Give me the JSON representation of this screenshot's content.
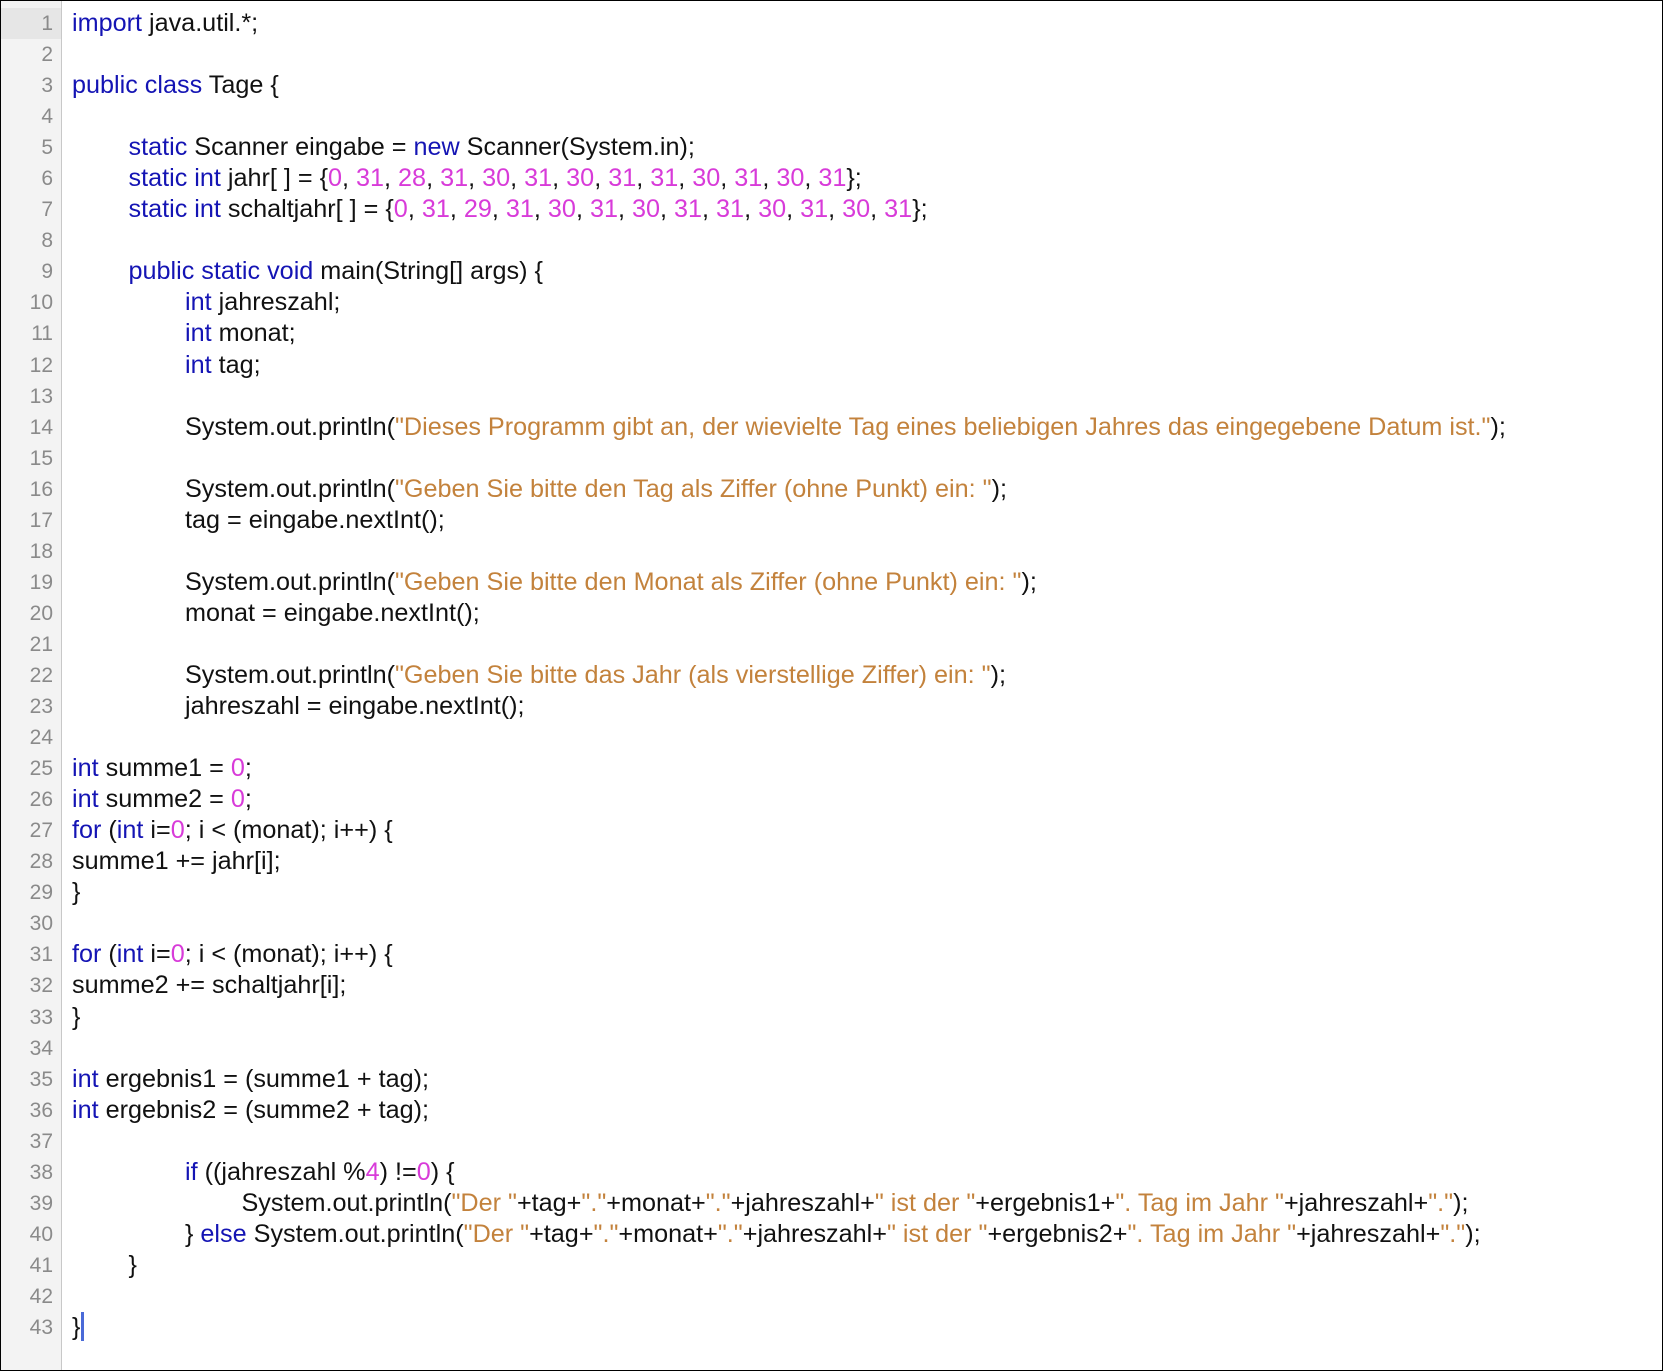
{
  "editor": {
    "current_line": 1,
    "caret_line": 43,
    "indent_unit": "      ",
    "colors": {
      "keyword": "#1414b4",
      "number": "#d83bd9",
      "string": "#c3823c",
      "plain": "#111111",
      "line_number": "#8a8a8a",
      "gutter": "#f3f3f3",
      "caret": "#4a6ad8"
    },
    "lines": [
      {
        "n": "1",
        "indent": 0,
        "tokens": [
          [
            "kw",
            "import"
          ],
          [
            "pl",
            " java.util.*;"
          ]
        ]
      },
      {
        "n": "2",
        "indent": 0,
        "tokens": []
      },
      {
        "n": "3",
        "indent": 0,
        "tokens": [
          [
            "kw",
            "public class"
          ],
          [
            "pl",
            " Tage {"
          ]
        ]
      },
      {
        "n": "4",
        "indent": 0,
        "tokens": []
      },
      {
        "n": "5",
        "indent": 1,
        "tokens": [
          [
            "kw",
            "static"
          ],
          [
            "pl",
            " Scanner eingabe = "
          ],
          [
            "kw",
            "new"
          ],
          [
            "pl",
            " Scanner(System.in);"
          ]
        ]
      },
      {
        "n": "6",
        "indent": 1,
        "tokens": [
          [
            "kw",
            "static int"
          ],
          [
            "pl",
            " jahr[ ] = {"
          ],
          [
            "num",
            "0"
          ],
          [
            "pl",
            ", "
          ],
          [
            "num",
            "31"
          ],
          [
            "pl",
            ", "
          ],
          [
            "num",
            "28"
          ],
          [
            "pl",
            ", "
          ],
          [
            "num",
            "31"
          ],
          [
            "pl",
            ", "
          ],
          [
            "num",
            "30"
          ],
          [
            "pl",
            ", "
          ],
          [
            "num",
            "31"
          ],
          [
            "pl",
            ", "
          ],
          [
            "num",
            "30"
          ],
          [
            "pl",
            ", "
          ],
          [
            "num",
            "31"
          ],
          [
            "pl",
            ", "
          ],
          [
            "num",
            "31"
          ],
          [
            "pl",
            ", "
          ],
          [
            "num",
            "30"
          ],
          [
            "pl",
            ", "
          ],
          [
            "num",
            "31"
          ],
          [
            "pl",
            ", "
          ],
          [
            "num",
            "30"
          ],
          [
            "pl",
            ", "
          ],
          [
            "num",
            "31"
          ],
          [
            "pl",
            "};"
          ]
        ]
      },
      {
        "n": "7",
        "indent": 1,
        "tokens": [
          [
            "kw",
            "static int"
          ],
          [
            "pl",
            " schaltjahr[ ] = {"
          ],
          [
            "num",
            "0"
          ],
          [
            "pl",
            ", "
          ],
          [
            "num",
            "31"
          ],
          [
            "pl",
            ", "
          ],
          [
            "num",
            "29"
          ],
          [
            "pl",
            ", "
          ],
          [
            "num",
            "31"
          ],
          [
            "pl",
            ", "
          ],
          [
            "num",
            "30"
          ],
          [
            "pl",
            ", "
          ],
          [
            "num",
            "31"
          ],
          [
            "pl",
            ", "
          ],
          [
            "num",
            "30"
          ],
          [
            "pl",
            ", "
          ],
          [
            "num",
            "31"
          ],
          [
            "pl",
            ", "
          ],
          [
            "num",
            "31"
          ],
          [
            "pl",
            ", "
          ],
          [
            "num",
            "30"
          ],
          [
            "pl",
            ", "
          ],
          [
            "num",
            "31"
          ],
          [
            "pl",
            ", "
          ],
          [
            "num",
            "30"
          ],
          [
            "pl",
            ", "
          ],
          [
            "num",
            "31"
          ],
          [
            "pl",
            "};"
          ]
        ]
      },
      {
        "n": "8",
        "indent": 0,
        "tokens": []
      },
      {
        "n": "9",
        "indent": 1,
        "tokens": [
          [
            "kw",
            "public static void"
          ],
          [
            "pl",
            " main(String[] args) {"
          ]
        ]
      },
      {
        "n": "10",
        "indent": 2,
        "tokens": [
          [
            "kw",
            "int"
          ],
          [
            "pl",
            " jahreszahl;"
          ]
        ]
      },
      {
        "n": "11",
        "indent": 2,
        "tokens": [
          [
            "kw",
            "int"
          ],
          [
            "pl",
            " monat;"
          ]
        ]
      },
      {
        "n": "12",
        "indent": 2,
        "tokens": [
          [
            "kw",
            "int"
          ],
          [
            "pl",
            " tag;"
          ]
        ]
      },
      {
        "n": "13",
        "indent": 0,
        "tokens": []
      },
      {
        "n": "14",
        "indent": 2,
        "tokens": [
          [
            "pl",
            "System.out.println("
          ],
          [
            "str",
            "\"Dieses Programm gibt an, der wievielte Tag eines beliebigen Jahres das eingegebene Datum ist.\""
          ],
          [
            "pl",
            ");"
          ]
        ]
      },
      {
        "n": "15",
        "indent": 0,
        "tokens": []
      },
      {
        "n": "16",
        "indent": 2,
        "tokens": [
          [
            "pl",
            "System.out.println("
          ],
          [
            "str",
            "\"Geben Sie bitte den Tag als Ziffer (ohne Punkt) ein: \""
          ],
          [
            "pl",
            ");"
          ]
        ]
      },
      {
        "n": "17",
        "indent": 2,
        "tokens": [
          [
            "pl",
            "tag = eingabe.nextInt();"
          ]
        ]
      },
      {
        "n": "18",
        "indent": 0,
        "tokens": []
      },
      {
        "n": "19",
        "indent": 2,
        "tokens": [
          [
            "pl",
            "System.out.println("
          ],
          [
            "str",
            "\"Geben Sie bitte den Monat als Ziffer (ohne Punkt) ein: \""
          ],
          [
            "pl",
            ");"
          ]
        ]
      },
      {
        "n": "20",
        "indent": 2,
        "tokens": [
          [
            "pl",
            "monat = eingabe.nextInt();"
          ]
        ]
      },
      {
        "n": "21",
        "indent": 0,
        "tokens": []
      },
      {
        "n": "22",
        "indent": 2,
        "tokens": [
          [
            "pl",
            "System.out.println("
          ],
          [
            "str",
            "\"Geben Sie bitte das Jahr (als vierstellige Ziffer) ein: \""
          ],
          [
            "pl",
            ");"
          ]
        ]
      },
      {
        "n": "23",
        "indent": 2,
        "tokens": [
          [
            "pl",
            "jahreszahl = eingabe.nextInt();"
          ]
        ]
      },
      {
        "n": "24",
        "indent": 0,
        "tokens": []
      },
      {
        "n": "25",
        "indent": 0,
        "tokens": [
          [
            "kw",
            "int"
          ],
          [
            "pl",
            " summe1 = "
          ],
          [
            "num",
            "0"
          ],
          [
            "pl",
            ";"
          ]
        ]
      },
      {
        "n": "26",
        "indent": 0,
        "tokens": [
          [
            "kw",
            "int"
          ],
          [
            "pl",
            " summe2 = "
          ],
          [
            "num",
            "0"
          ],
          [
            "pl",
            ";"
          ]
        ]
      },
      {
        "n": "27",
        "indent": 0,
        "tokens": [
          [
            "kw",
            "for"
          ],
          [
            "pl",
            " ("
          ],
          [
            "kw",
            "int"
          ],
          [
            "pl",
            " i="
          ],
          [
            "num",
            "0"
          ],
          [
            "pl",
            "; i < (monat); i++) {"
          ]
        ]
      },
      {
        "n": "28",
        "indent": 0,
        "tokens": [
          [
            "pl",
            "summe1 += jahr[i];"
          ]
        ]
      },
      {
        "n": "29",
        "indent": 0,
        "tokens": [
          [
            "pl",
            "}"
          ]
        ]
      },
      {
        "n": "30",
        "indent": 0,
        "tokens": []
      },
      {
        "n": "31",
        "indent": 0,
        "tokens": [
          [
            "kw",
            "for"
          ],
          [
            "pl",
            " ("
          ],
          [
            "kw",
            "int"
          ],
          [
            "pl",
            " i="
          ],
          [
            "num",
            "0"
          ],
          [
            "pl",
            "; i < (monat); i++) {"
          ]
        ]
      },
      {
        "n": "32",
        "indent": 0,
        "tokens": [
          [
            "pl",
            "summe2 += schaltjahr[i];"
          ]
        ]
      },
      {
        "n": "33",
        "indent": 0,
        "tokens": [
          [
            "pl",
            "}"
          ]
        ]
      },
      {
        "n": "34",
        "indent": 0,
        "tokens": []
      },
      {
        "n": "35",
        "indent": 0,
        "tokens": [
          [
            "kw",
            "int"
          ],
          [
            "pl",
            " ergebnis1 = (summe1 + tag);"
          ]
        ]
      },
      {
        "n": "36",
        "indent": 0,
        "tokens": [
          [
            "kw",
            "int"
          ],
          [
            "pl",
            " ergebnis2 = (summe2 + tag);"
          ]
        ]
      },
      {
        "n": "37",
        "indent": 0,
        "tokens": []
      },
      {
        "n": "38",
        "indent": 2,
        "tokens": [
          [
            "kw",
            "if"
          ],
          [
            "pl",
            " ((jahreszahl %"
          ],
          [
            "num",
            "4"
          ],
          [
            "pl",
            ") !="
          ],
          [
            "num",
            "0"
          ],
          [
            "pl",
            ") {"
          ]
        ]
      },
      {
        "n": "39",
        "indent": 3,
        "tokens": [
          [
            "pl",
            "System.out.println("
          ],
          [
            "str",
            "\"Der \""
          ],
          [
            "pl",
            "+tag+"
          ],
          [
            "str",
            "\".\""
          ],
          [
            "pl",
            "+monat+"
          ],
          [
            "str",
            "\".\""
          ],
          [
            "pl",
            "+jahreszahl+"
          ],
          [
            "str",
            "\" ist der \""
          ],
          [
            "pl",
            "+ergebnis1+"
          ],
          [
            "str",
            "\". Tag im Jahr \""
          ],
          [
            "pl",
            "+jahreszahl+"
          ],
          [
            "str",
            "\".\""
          ],
          [
            "pl",
            ");"
          ]
        ]
      },
      {
        "n": "40",
        "indent": 2,
        "tokens": [
          [
            "pl",
            "} "
          ],
          [
            "kw",
            "else"
          ],
          [
            "pl",
            " System.out.println("
          ],
          [
            "str",
            "\"Der \""
          ],
          [
            "pl",
            "+tag+"
          ],
          [
            "str",
            "\".\""
          ],
          [
            "pl",
            "+monat+"
          ],
          [
            "str",
            "\".\""
          ],
          [
            "pl",
            "+jahreszahl+"
          ],
          [
            "str",
            "\" ist der \""
          ],
          [
            "pl",
            "+ergebnis2+"
          ],
          [
            "str",
            "\". Tag im Jahr \""
          ],
          [
            "pl",
            "+jahreszahl+"
          ],
          [
            "str",
            "\".\""
          ],
          [
            "pl",
            ");"
          ]
        ]
      },
      {
        "n": "41",
        "indent": 1,
        "tokens": [
          [
            "pl",
            "}"
          ]
        ]
      },
      {
        "n": "42",
        "indent": 0,
        "tokens": []
      },
      {
        "n": "43",
        "indent": 0,
        "tokens": [
          [
            "pl",
            "}"
          ]
        ]
      }
    ]
  }
}
